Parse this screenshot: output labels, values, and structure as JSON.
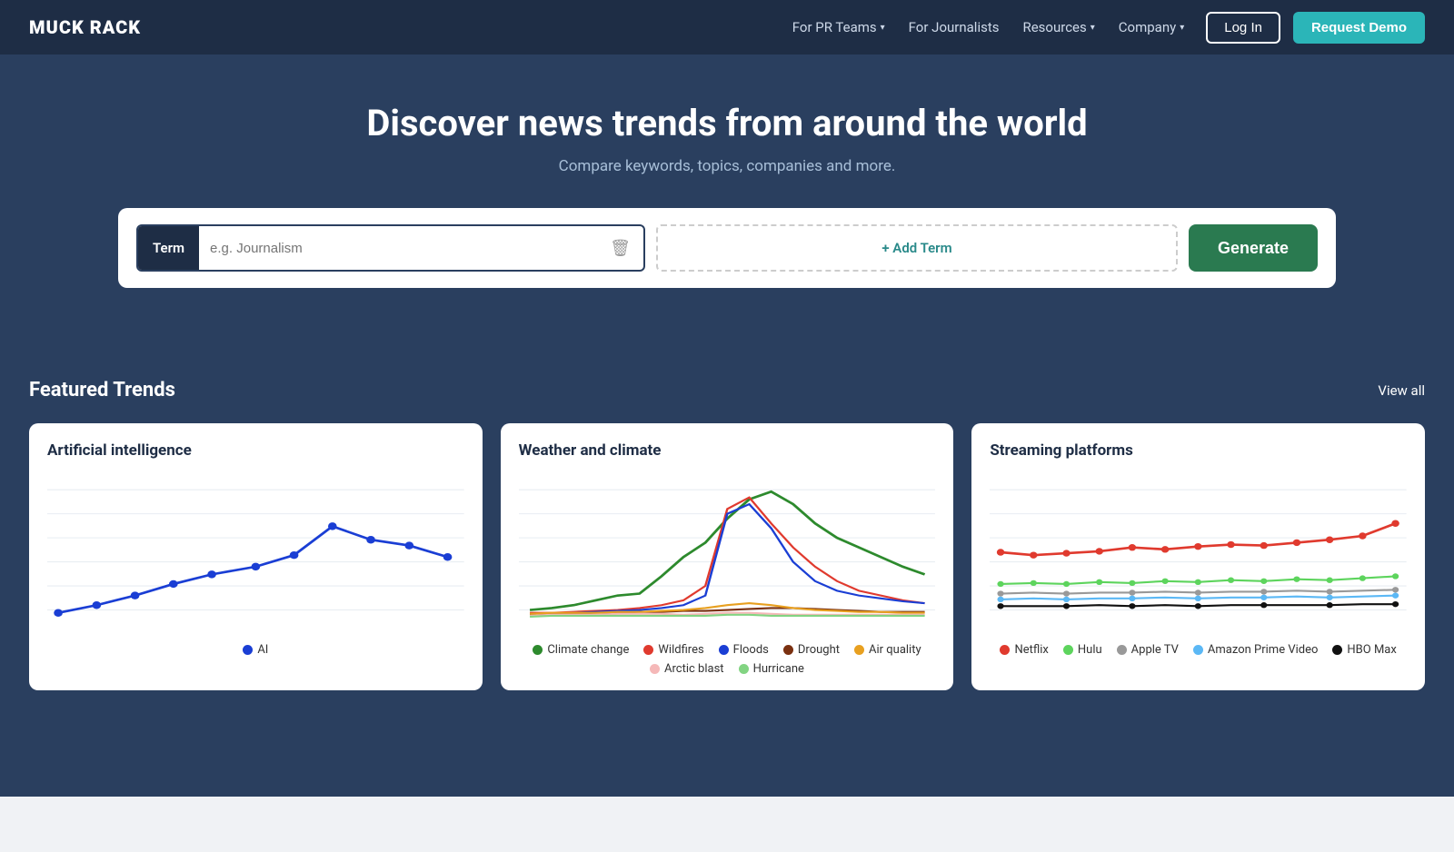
{
  "nav": {
    "logo": "MUCK RACK",
    "links": [
      {
        "label": "For PR Teams",
        "has_dropdown": true
      },
      {
        "label": "For Journalists",
        "has_dropdown": false
      },
      {
        "label": "Resources",
        "has_dropdown": true
      },
      {
        "label": "Company",
        "has_dropdown": true
      }
    ],
    "login_label": "Log In",
    "demo_label": "Request Demo"
  },
  "hero": {
    "title": "Discover news trends from around the world",
    "subtitle": "Compare keywords, topics, companies and more."
  },
  "search": {
    "term_label": "Term",
    "term_placeholder": "e.g. Journalism",
    "add_term_label": "+ Add Term",
    "generate_label": "Generate"
  },
  "trends": {
    "section_title": "Featured Trends",
    "view_all_label": "View all",
    "cards": [
      {
        "id": "ai",
        "title": "Artificial intelligence",
        "legend": [
          {
            "label": "AI",
            "color": "#1a3ed4"
          }
        ]
      },
      {
        "id": "weather",
        "title": "Weather and climate",
        "legend": [
          {
            "label": "Climate change",
            "color": "#2d8a2d"
          },
          {
            "label": "Wildfires",
            "color": "#e03a2e"
          },
          {
            "label": "Floods",
            "color": "#1a3ed4"
          },
          {
            "label": "Drought",
            "color": "#7a3010"
          },
          {
            "label": "Air quality",
            "color": "#e8a020"
          },
          {
            "label": "Arctic blast",
            "color": "#f5b8b8"
          },
          {
            "label": "Hurricane",
            "color": "#82d482"
          }
        ]
      },
      {
        "id": "streaming",
        "title": "Streaming platforms",
        "legend": [
          {
            "label": "Netflix",
            "color": "#e03a2e"
          },
          {
            "label": "Hulu",
            "color": "#5dd45d"
          },
          {
            "label": "Apple TV",
            "color": "#999999"
          },
          {
            "label": "Amazon Prime Video",
            "color": "#5bb8f5"
          },
          {
            "label": "HBO Max",
            "color": "#111111"
          }
        ]
      }
    ]
  }
}
